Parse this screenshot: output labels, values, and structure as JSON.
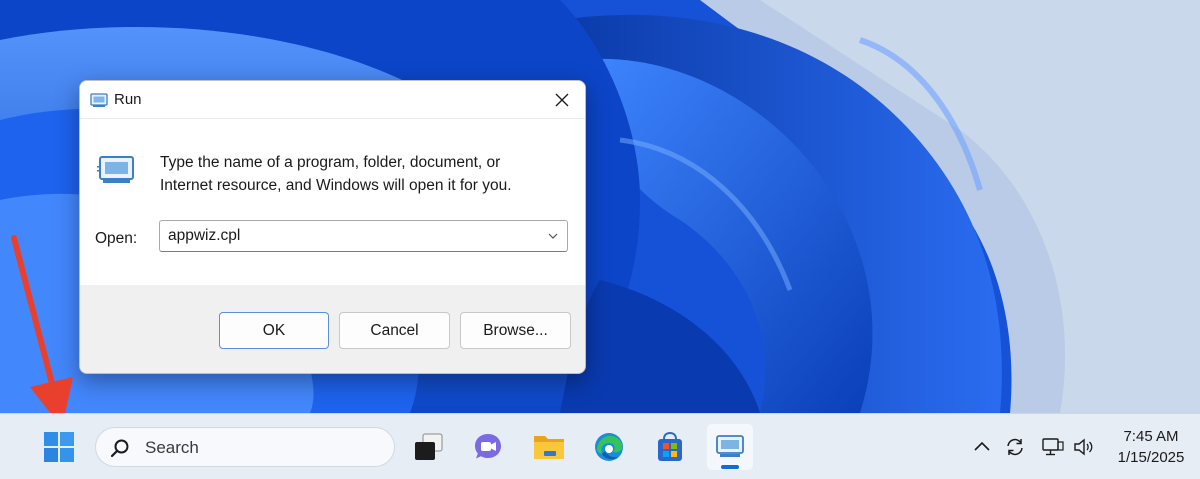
{
  "dialog": {
    "title": "Run",
    "prompt_line1": "Type the name of a program, folder, document, or",
    "prompt_line2": "Internet resource, and Windows will open it for you.",
    "open_label": "Open:",
    "open_value": "appwiz.cpl",
    "ok_label": "OK",
    "cancel_label": "Cancel",
    "browse_label": "Browse..."
  },
  "taskbar": {
    "search_label": "Search",
    "apps": [
      "task-view",
      "teams-chat",
      "file-explorer",
      "edge",
      "microsoft-store",
      "run"
    ],
    "active_app": "run",
    "tray": [
      "chevron-up-icon",
      "sync-icon",
      "network-icon",
      "speaker-icon"
    ],
    "time": "7:45 AM",
    "date": "1/15/2025"
  },
  "colors": {
    "accent": "#0f6cd8",
    "annotation_arrow": "#e8402c",
    "wallpaper": "#1a5fe6"
  }
}
